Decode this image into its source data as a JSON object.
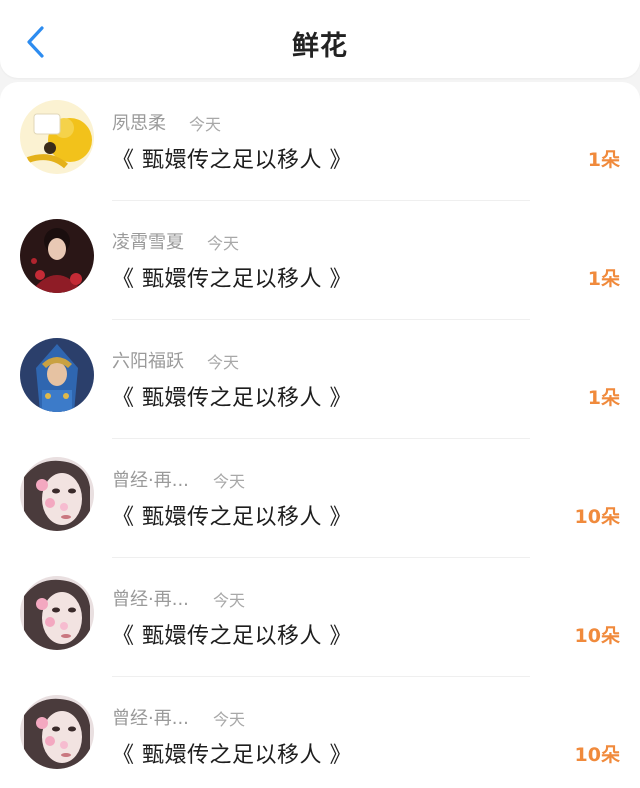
{
  "header": {
    "title": "鲜花",
    "back_icon": "chevron-left-icon",
    "accent_color": "#2d8cf0"
  },
  "records": [
    {
      "name": "夙思柔",
      "time": "今天",
      "book": "《 甄嬛传之足以移人 》",
      "amount": "1朵",
      "avatar": "yellow-costume-avatar"
    },
    {
      "name": "凌霄雪夏",
      "time": "今天",
      "book": "《 甄嬛传之足以移人 》",
      "amount": "1朵",
      "avatar": "red-dress-woman-avatar"
    },
    {
      "name": "六阳福跃",
      "time": "今天",
      "book": "《 甄嬛传之足以移人 》",
      "amount": "1朵",
      "avatar": "hooded-warrior-avatar"
    },
    {
      "name": "曾经·再...",
      "time": "今天",
      "book": "《 甄嬛传之足以移人 》",
      "amount": "10朵",
      "avatar": "flower-mask-girl-avatar"
    },
    {
      "name": "曾经·再...",
      "time": "今天",
      "book": "《 甄嬛传之足以移人 》",
      "amount": "10朵",
      "avatar": "flower-mask-girl-avatar"
    },
    {
      "name": "曾经·再...",
      "time": "今天",
      "book": "《 甄嬛传之足以移人 》",
      "amount": "10朵",
      "avatar": "flower-mask-girl-avatar"
    }
  ],
  "colors": {
    "amount": "#f08a3c",
    "name": "#9a9a9a",
    "book": "#1e1e1e"
  }
}
